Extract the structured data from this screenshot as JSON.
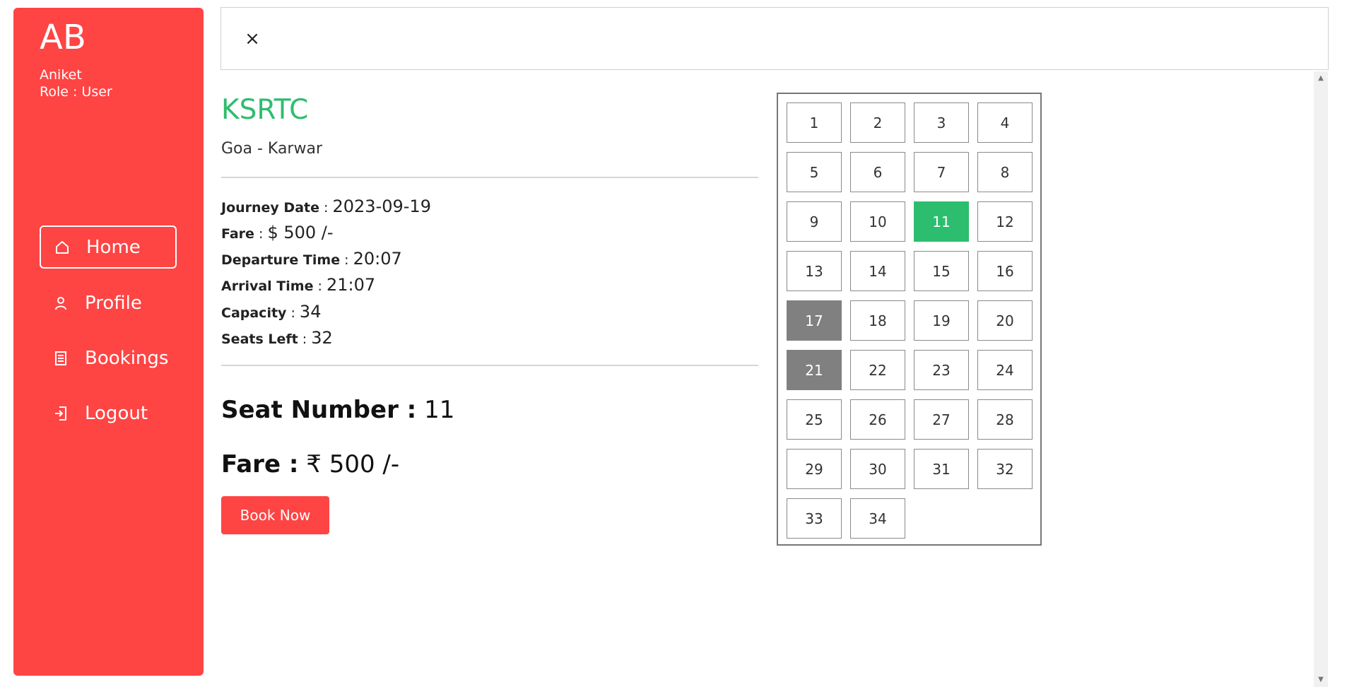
{
  "sidebar": {
    "initials": "AB",
    "user_name": "Aniket",
    "role": "Role : User",
    "items": [
      {
        "label": "Home",
        "icon": "home-icon",
        "active": true
      },
      {
        "label": "Profile",
        "icon": "user-icon",
        "active": false
      },
      {
        "label": "Bookings",
        "icon": "document-icon",
        "active": false
      },
      {
        "label": "Logout",
        "icon": "logout-icon",
        "active": false
      }
    ],
    "bg_color": "#ff4444"
  },
  "topbar": {
    "close_label": "×"
  },
  "bus": {
    "name": "KSRTC",
    "route": "Goa - Karwar",
    "details": [
      {
        "label": "Journey Date",
        "value": "2023-09-19"
      },
      {
        "label": "Fare",
        "value": "$ 500 /-"
      },
      {
        "label": "Departure Time",
        "value": "20:07"
      },
      {
        "label": "Arrival Time",
        "value": "21:07"
      },
      {
        "label": "Capacity",
        "value": "34"
      },
      {
        "label": "Seats Left",
        "value": "32"
      }
    ],
    "name_color": "#2dbd6e"
  },
  "selection": {
    "seat_label": "Seat Number :",
    "seat_value": "11",
    "fare_label": "Fare :",
    "fare_value": "₹ 500 /-",
    "book_button": "Book Now"
  },
  "seats": {
    "list": [
      "1",
      "2",
      "3",
      "4",
      "5",
      "6",
      "7",
      "8",
      "9",
      "10",
      "11",
      "12",
      "13",
      "14",
      "15",
      "16",
      "17",
      "18",
      "19",
      "20",
      "21",
      "22",
      "23",
      "24",
      "25",
      "26",
      "27",
      "28",
      "29",
      "30",
      "31",
      "32",
      "33",
      "34"
    ],
    "selected": [
      "11"
    ],
    "booked": [
      "17",
      "21"
    ],
    "colors": {
      "selected": "#2dbd6e",
      "booked": "#808080"
    }
  }
}
